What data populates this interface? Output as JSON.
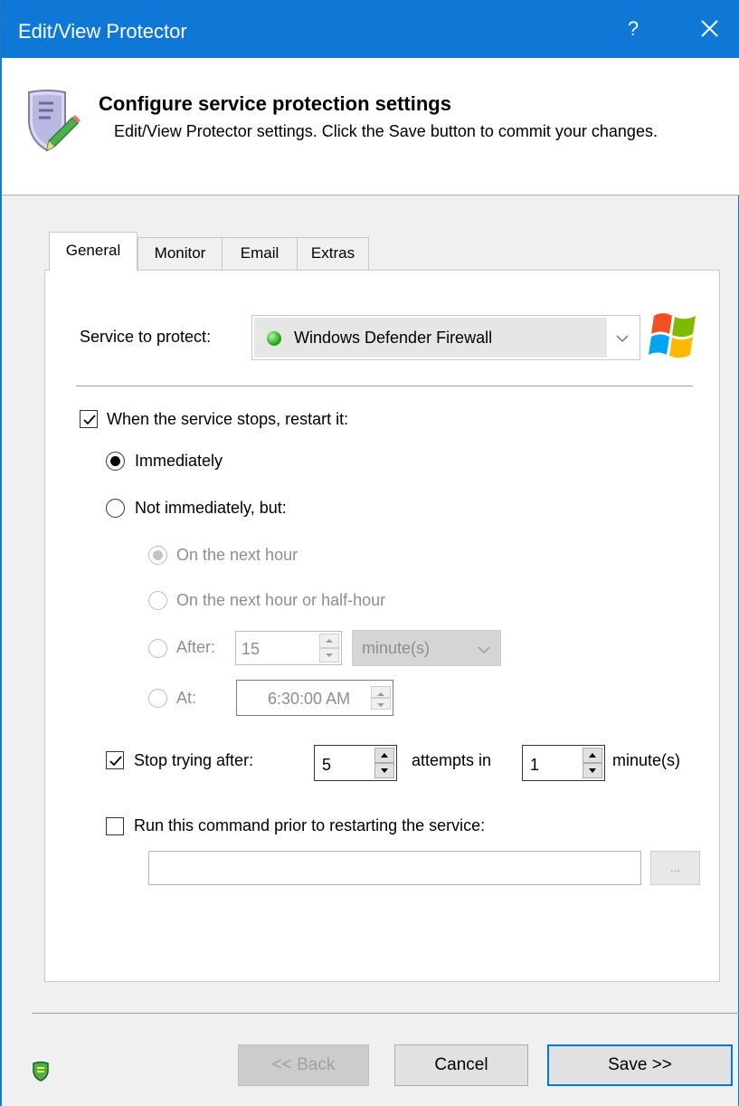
{
  "window": {
    "title": "Edit/View Protector",
    "help_label": "?"
  },
  "header": {
    "title": "Configure service protection settings",
    "subtitle": "Edit/View Protector settings. Click the Save button to commit your changes."
  },
  "tabs": [
    {
      "label": "General",
      "active": true
    },
    {
      "label": "Monitor",
      "active": false
    },
    {
      "label": "Email",
      "active": false
    },
    {
      "label": "Extras",
      "active": false
    }
  ],
  "general": {
    "service_label": "Service to protect:",
    "service_value": "Windows Defender Firewall",
    "service_status_color": "#22b01a",
    "restart_checkbox_label": "When the service stops, restart it:",
    "restart_checked": true,
    "immediately_label": "Immediately",
    "immediately_selected": true,
    "not_immediately_label": "Not immediately, but:",
    "next_hour_label": "On the next hour",
    "next_half_hour_label": "On the next hour or half-hour",
    "after_label": "After:",
    "after_value": "15",
    "after_unit": "minute(s)",
    "at_label": "At:",
    "at_value": "6:30:00 AM",
    "stop_trying_label": "Stop trying after:",
    "stop_trying_checked": true,
    "attempts_value": "5",
    "attempts_in_label": "attempts in",
    "minutes_value": "1",
    "minutes_label": "minute(s)",
    "run_command_label": "Run this command prior to restarting the service:",
    "run_command_checked": false,
    "command_value": "",
    "browse_label": "..."
  },
  "footer": {
    "back_label": "<< Back",
    "cancel_label": "Cancel",
    "save_label": "Save >>"
  },
  "colors": {
    "titlebar": "#0f78d7",
    "default_button_border": "#0078d7"
  }
}
